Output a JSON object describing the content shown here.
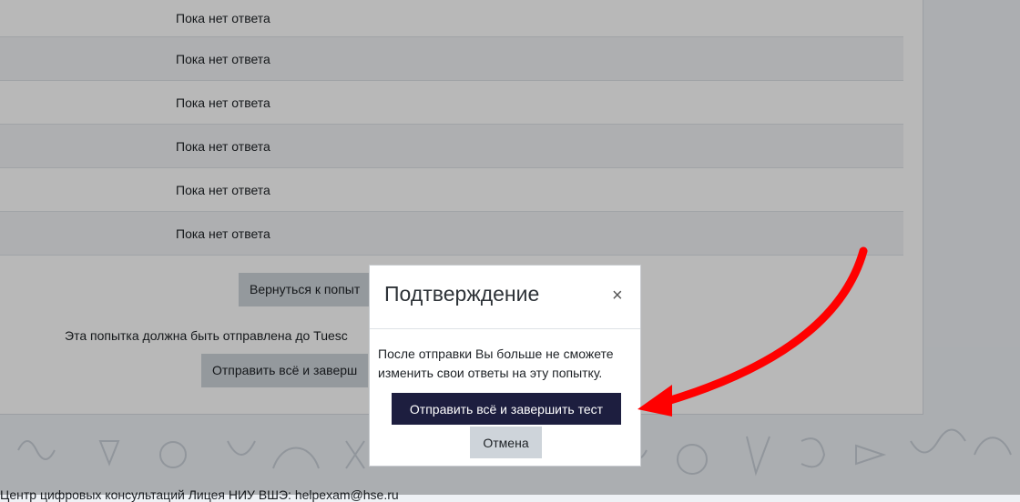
{
  "summary": {
    "rows": [
      {
        "status": "Пока нет ответа"
      },
      {
        "status": "Пока нет ответа"
      },
      {
        "status": "Пока нет ответа"
      },
      {
        "status": "Пока нет ответа"
      },
      {
        "status": "Пока нет ответа"
      },
      {
        "status": "Пока нет ответа"
      }
    ]
  },
  "page": {
    "return_button": "Вернуться к попыт",
    "deadline_text": "Эта попытка должна быть отправлена до Tuesc",
    "submit_button": "Отправить всё и заверш",
    "footer_text": "Центр цифровых консультаций Лицея НИУ ВШЭ: helpexam@hse.ru"
  },
  "modal": {
    "title": "Подтверждение",
    "close_symbol": "×",
    "body": "После отправки Вы больше не сможете изменить свои ответы на эту попытку.",
    "submit_label": "Отправить всё и завершить тест",
    "cancel_label": "Отмена"
  },
  "colors": {
    "primary": "#1d1e3f",
    "secondary": "#ced4da",
    "annotation_arrow": "#ff0000"
  },
  "icons": {
    "close": "close-icon",
    "arrow": "red-arrow-annotation"
  }
}
